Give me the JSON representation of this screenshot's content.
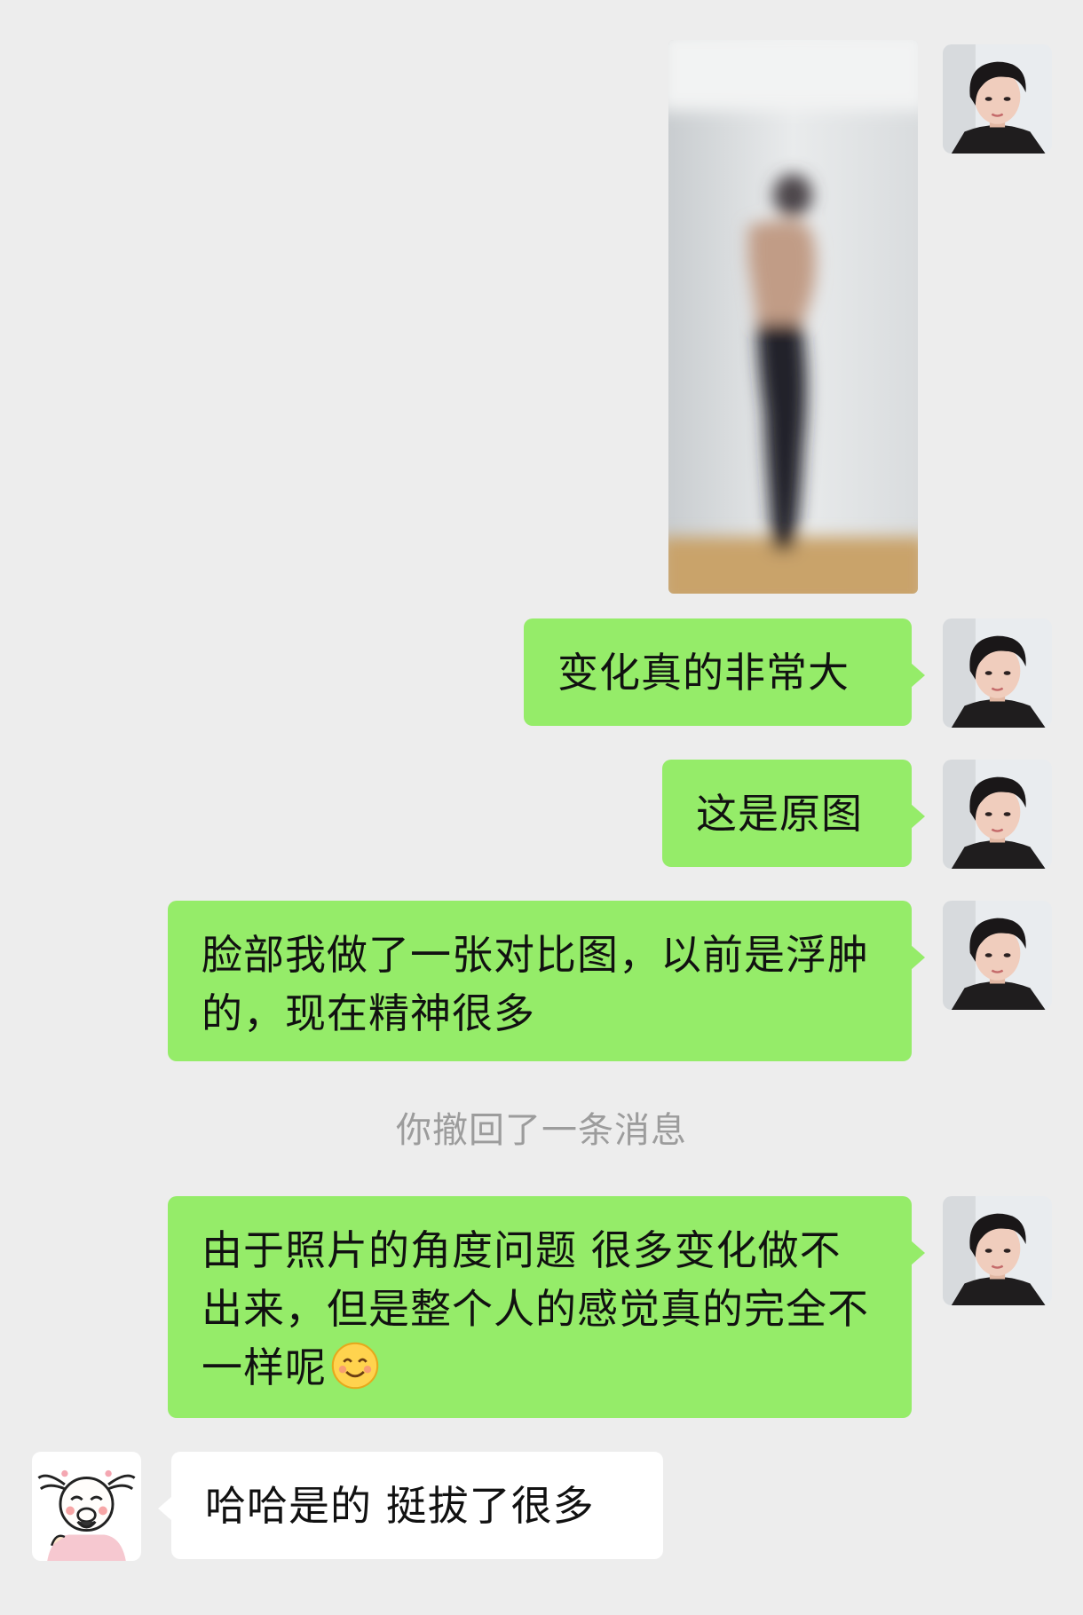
{
  "conversation": {
    "messages": [
      {
        "sender": "me",
        "type": "image",
        "image_desc": "blurred photo"
      },
      {
        "sender": "me",
        "type": "text",
        "text": "变化真的非常大"
      },
      {
        "sender": "me",
        "type": "text",
        "text": "这是原图"
      },
      {
        "sender": "me",
        "type": "text",
        "text": "脸部我做了一张对比图，以前是浮肿的，现在精神很多"
      },
      {
        "sender": "me",
        "type": "text",
        "text": "由于照片的角度问题  很多变化做不出来，但是整个人的感觉真的完全不一样呢",
        "emoji": "smiling-face-emoji"
      },
      {
        "sender": "other",
        "type": "text",
        "text": "哈哈是的 挺拔了很多"
      }
    ],
    "system_notice": "你撤回了一条消息"
  },
  "colors": {
    "background": "#ededed",
    "bubble_me": "#95ec69",
    "bubble_other": "#ffffff",
    "notice_text": "#9c9c9c"
  }
}
